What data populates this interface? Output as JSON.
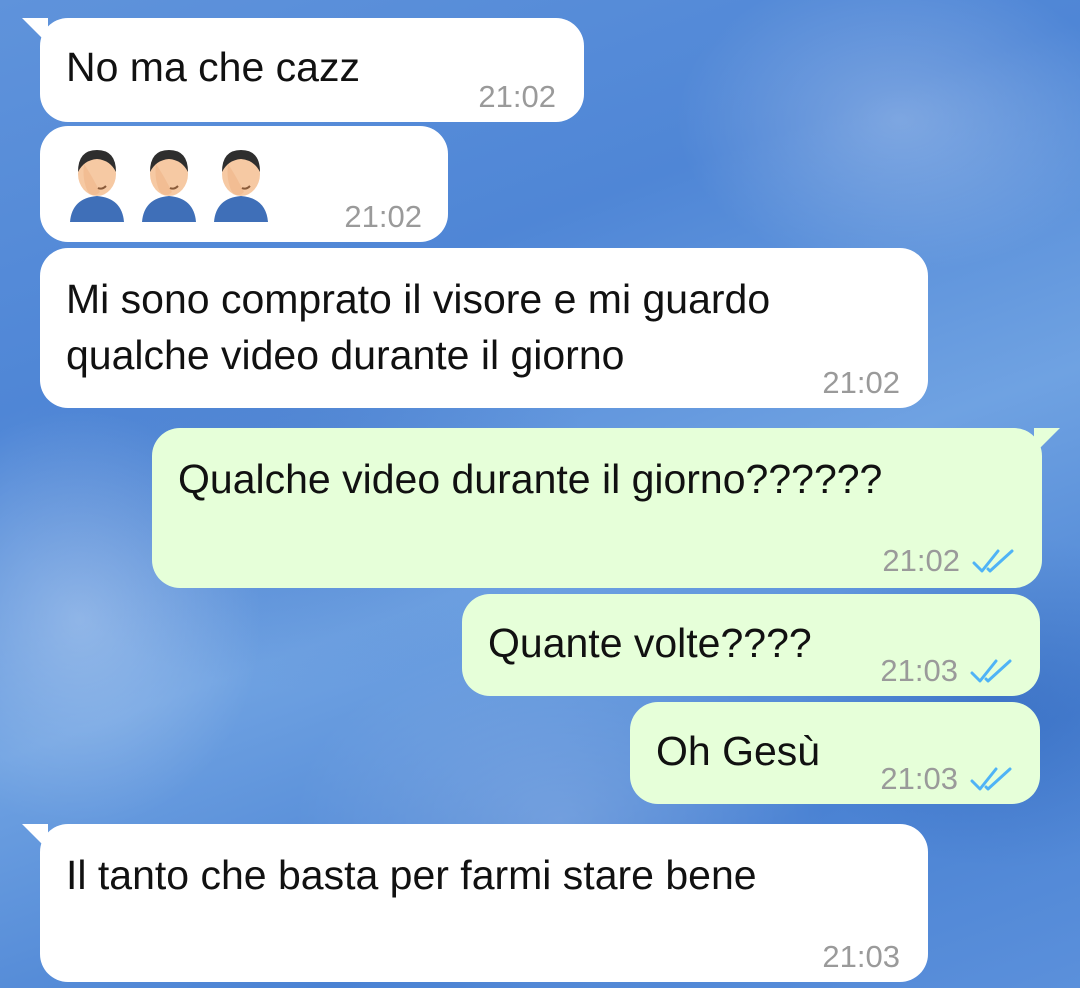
{
  "colors": {
    "incoming_bubble": "#ffffff",
    "outgoing_bubble": "#e6ffd9",
    "timestamp": "#9a9a9a",
    "read_ticks": "#4fb3f6"
  },
  "messages": [
    {
      "direction": "incoming",
      "text": "No ma che cazz",
      "time": "21:02"
    },
    {
      "direction": "incoming",
      "emoji": "man-facepalming",
      "emoji_count": 3,
      "time": "21:02"
    },
    {
      "direction": "incoming",
      "lines": [
        "Mi sono comprato il visore e mi guardo",
        "qualche video durante il giorno"
      ],
      "time": "21:02"
    },
    {
      "direction": "outgoing",
      "text": "Qualche video durante il giorno??????",
      "time": "21:02",
      "status_icon": "double-check-read-icon"
    },
    {
      "direction": "outgoing",
      "text": "Quante volte????",
      "time": "21:03",
      "status_icon": "double-check-read-icon"
    },
    {
      "direction": "outgoing",
      "text": "Oh Gesù",
      "time": "21:03",
      "status_icon": "double-check-read-icon"
    },
    {
      "direction": "incoming",
      "text": "Il tanto che basta per farmi stare bene",
      "time": "21:03"
    }
  ]
}
